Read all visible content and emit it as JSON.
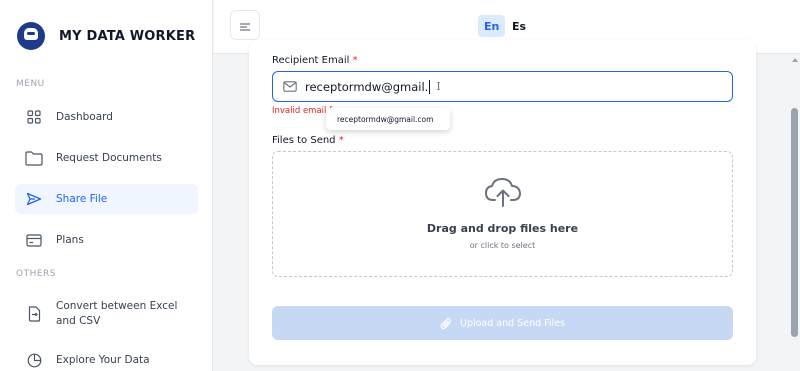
{
  "brand": {
    "name": "MY DATA WORKER"
  },
  "sidebar": {
    "menu_label": "MENU",
    "others_label": "OTHERS",
    "items": [
      {
        "label": "Dashboard",
        "icon": "grid-icon"
      },
      {
        "label": "Request Documents",
        "icon": "folder-icon"
      },
      {
        "label": "Share File",
        "icon": "send-icon",
        "active": true
      },
      {
        "label": "Plans",
        "icon": "card-icon"
      }
    ],
    "others": [
      {
        "label": "Convert between Excel and CSV",
        "icon": "file-convert-icon"
      },
      {
        "label": "Explore Your Data",
        "icon": "pie-chart-icon"
      }
    ]
  },
  "header": {
    "languages": [
      "En",
      "Es"
    ],
    "active_language": "En"
  },
  "form": {
    "email_label": "Recipient Email",
    "required_mark": "*",
    "email_value": "receptormdw@gmail.",
    "email_error": "Invalid email fc",
    "suggestion": "receptormdw@gmail.com",
    "files_label": "Files to Send",
    "drop_title": "Drag and drop files here",
    "drop_sub": "or click to select",
    "upload_button": "Upload and Send Files"
  },
  "colors": {
    "accent": "#2563eb",
    "error": "#dc2626",
    "disabled_button": "#c7d8f5",
    "brand_logo": "#1e3a8a"
  }
}
